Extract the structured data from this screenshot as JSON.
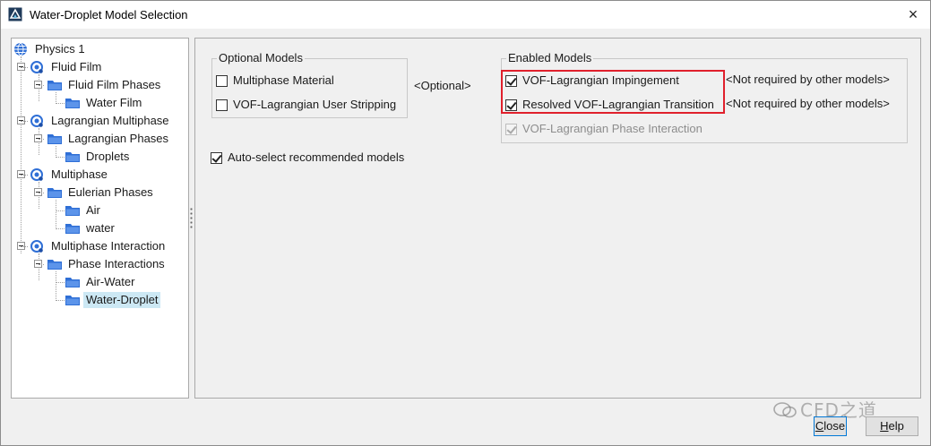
{
  "window": {
    "title": "Water-Droplet Model Selection",
    "close_glyph": "×"
  },
  "tree": {
    "root": "Physics 1",
    "items": [
      {
        "label": "Fluid Film"
      },
      {
        "label": "Fluid Film Phases"
      },
      {
        "label": "Water Film"
      },
      {
        "label": "Lagrangian Multiphase"
      },
      {
        "label": "Lagrangian Phases"
      },
      {
        "label": "Droplets"
      },
      {
        "label": "Multiphase"
      },
      {
        "label": "Eulerian Phases"
      },
      {
        "label": "Air"
      },
      {
        "label": "water"
      },
      {
        "label": "Multiphase Interaction"
      },
      {
        "label": "Phase Interactions"
      },
      {
        "label": "Air-Water"
      },
      {
        "label": "Water-Droplet"
      }
    ],
    "selected": "Water-Droplet"
  },
  "optional_models": {
    "title": "Optional Models",
    "items": [
      {
        "label": "Multiphase Material",
        "checked": false
      },
      {
        "label": "VOF-Lagrangian User Stripping",
        "checked": false
      }
    ],
    "between_label": "<Optional>"
  },
  "enabled_models": {
    "title": "Enabled Models",
    "items": [
      {
        "label": "VOF-Lagrangian Impingement",
        "checked": true,
        "note": "<Not required by other models>"
      },
      {
        "label": "Resolved VOF-Lagrangian Transition",
        "checked": true,
        "note": "<Not required by other models>"
      },
      {
        "label": "VOF-Lagrangian Phase Interaction",
        "checked": true,
        "disabled": true
      }
    ]
  },
  "auto_select": {
    "label": "Auto-select recommended models",
    "checked": true
  },
  "buttons": {
    "close": {
      "label": "Close",
      "mnemonic": "C",
      "rest": "lose"
    },
    "help": {
      "label": "Help",
      "mnemonic": "H",
      "rest": "elp"
    }
  },
  "watermark": {
    "text": "CFD之道"
  },
  "colors": {
    "highlight": "#e0202c",
    "folder": "#2f6fd6",
    "selection": "#cce8f4"
  }
}
